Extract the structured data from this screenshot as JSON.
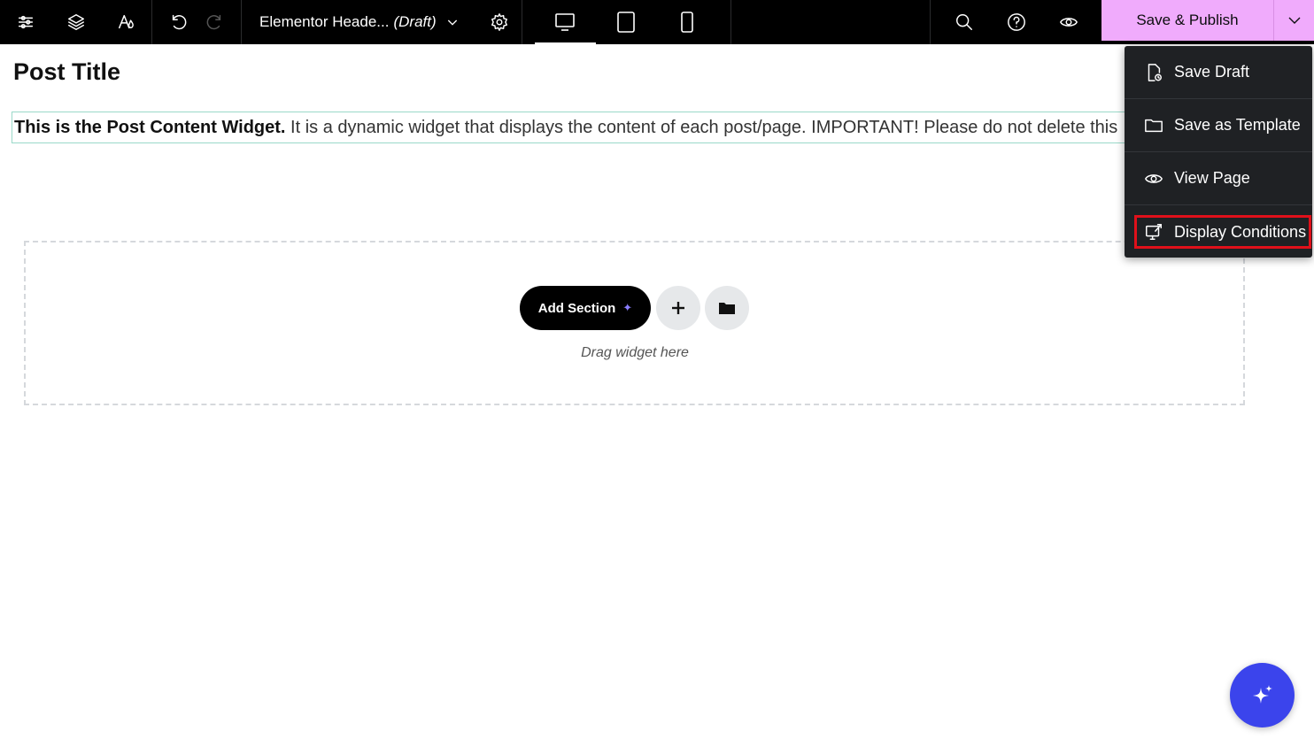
{
  "topbar": {
    "document_title": "Elementor Heade...",
    "document_status": "(Draft)",
    "publish_label": "Save & Publish"
  },
  "canvas": {
    "post_title": "Post Title",
    "post_content_bold": "This is the Post Content Widget.",
    "post_content_rest": " It is a dynamic widget that displays the content of each post/page. IMPORTANT! Please do not delete this",
    "add_section_label": "Add Section",
    "drag_hint": "Drag widget here"
  },
  "publish_menu": {
    "items": [
      {
        "label": "Save Draft",
        "icon": "save-draft-icon"
      },
      {
        "label": "Save as Template",
        "icon": "folder-icon"
      },
      {
        "label": "View Page",
        "icon": "eye-icon"
      },
      {
        "label": "Display Conditions",
        "icon": "display-conditions-icon"
      }
    ]
  },
  "colors": {
    "topbar_bg": "#000000",
    "publish_bg": "#f0abfc",
    "menu_bg": "#1f2124",
    "highlight_outline": "#e0101a",
    "ai_button": "#3b44ec"
  }
}
